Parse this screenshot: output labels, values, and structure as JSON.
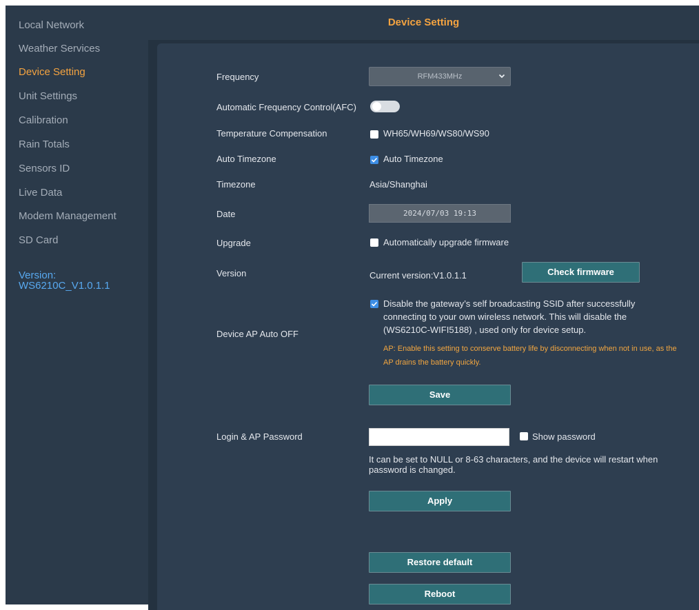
{
  "sidebar": {
    "items": [
      {
        "label": "Local Network"
      },
      {
        "label": "Weather Services"
      },
      {
        "label": "Device Setting",
        "active": true
      },
      {
        "label": "Unit Settings"
      },
      {
        "label": "Calibration"
      },
      {
        "label": "Rain Totals"
      },
      {
        "label": "Sensors ID"
      },
      {
        "label": "Live Data"
      },
      {
        "label": "Modem Management"
      },
      {
        "label": "SD Card"
      }
    ],
    "version_label": "Version:",
    "version_value": "WS6210C_V1.0.1.1"
  },
  "header": {
    "title": "Device Setting"
  },
  "form": {
    "frequency": {
      "label": "Frequency",
      "value": "RFM433MHz"
    },
    "afc": {
      "label": "Automatic Frequency Control(AFC)",
      "enabled": false
    },
    "temp_comp": {
      "label": "Temperature Compensation",
      "option": "WH65/WH69/WS80/WS90",
      "checked": false
    },
    "auto_timezone": {
      "label": "Auto Timezone",
      "option": "Auto Timezone",
      "checked": true
    },
    "timezone": {
      "label": "Timezone",
      "value": "Asia/Shanghai"
    },
    "date": {
      "label": "Date",
      "value": "2024/07/03 19:13"
    },
    "upgrade": {
      "label": "Upgrade",
      "option": "Automatically upgrade firmware",
      "checked": false
    },
    "version": {
      "label": "Version",
      "current": "Current version:V1.0.1.1",
      "check_button": "Check firmware"
    },
    "ap_auto_off": {
      "label": "Device AP Auto OFF",
      "checked": true,
      "line1": "Disable the gateway’s self broadcasting SSID after successfully",
      "line2": "connecting to your own wireless network. This will disable the",
      "line3": "(WS6210C-WIFI5188) , used only for device setup.",
      "warn1": "AP: Enable this setting to conserve battery life by disconnecting when not in use, as the",
      "warn2": "AP drains the battery quickly."
    },
    "save_button": "Save",
    "password": {
      "label": "Login & AP Password",
      "value": "",
      "show_option": "Show password",
      "show_checked": false,
      "hint": "It can be set to NULL or 8-63 characters, and the device will restart when password is changed."
    },
    "apply_button": "Apply",
    "restore_button": "Restore default",
    "reboot_button": "Reboot"
  },
  "colors": {
    "accent": "#f4a340",
    "version": "#58a9f0",
    "button": "#2f6f77",
    "checkbox": "#3d8ee6"
  }
}
